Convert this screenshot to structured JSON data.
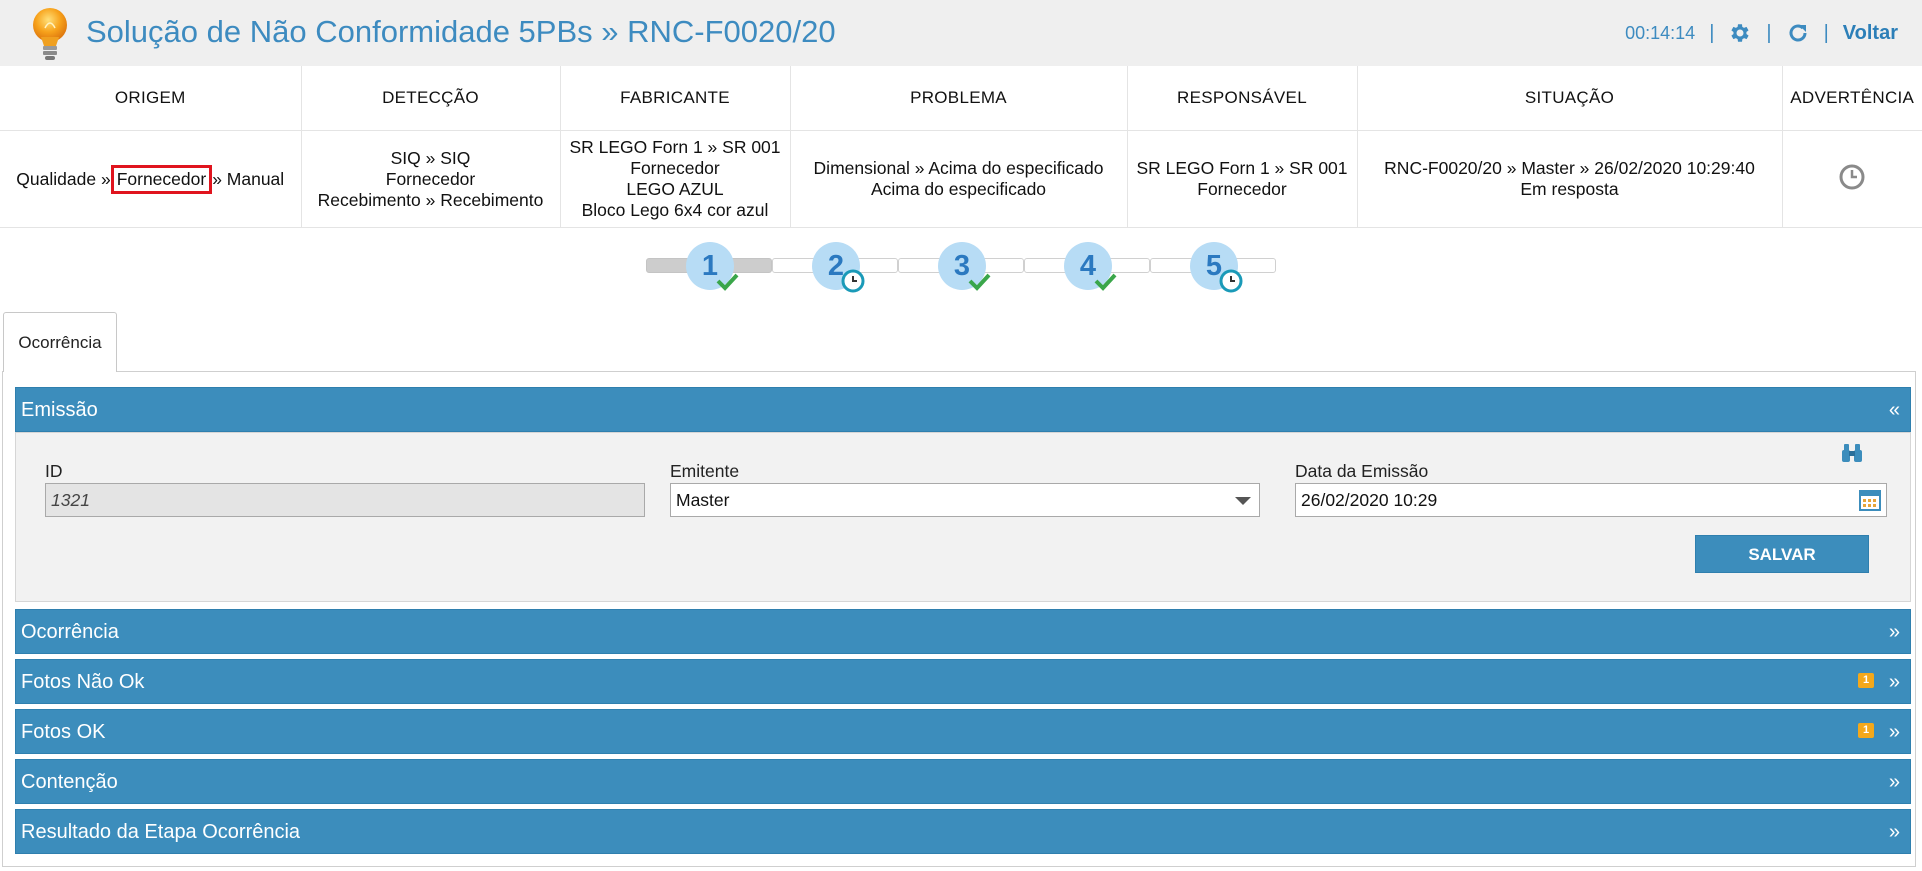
{
  "header": {
    "title": "Solução de Não Conformidade 5PBs » RNC-F0020/20",
    "timer": "00:14:14",
    "back_label": "Voltar",
    "icons": [
      "lightbulb-icon",
      "gear-icon",
      "refresh-icon"
    ]
  },
  "summary": {
    "columns": [
      "ORIGEM",
      "DETECÇÃO",
      "FABRICANTE",
      "PROBLEMA",
      "RESPONSÁVEL",
      "SITUAÇÃO",
      "ADVERTÊNCIA"
    ],
    "origem": {
      "part1": "Qualidade »",
      "highlight": "Fornecedor",
      "part3": "» Manual"
    },
    "deteccao": [
      "SIQ » SIQ",
      "Fornecedor",
      "Recebimento » Recebimento"
    ],
    "fabricante": [
      "SR LEGO Forn 1 » SR 001",
      "Fornecedor",
      "LEGO AZUL",
      "Bloco Lego 6x4 cor azul"
    ],
    "problema": [
      "Dimensional » Acima do especificado",
      "Acima do especificado"
    ],
    "responsavel": [
      "SR LEGO Forn 1 » SR 001",
      "Fornecedor"
    ],
    "situacao": [
      "RNC-F0020/20 » Master » 26/02/2020 10:29:40",
      "Em resposta"
    ],
    "advertencia_icon": "clock-icon"
  },
  "steps": [
    {
      "number": "1",
      "status": "check"
    },
    {
      "number": "2",
      "status": "clock"
    },
    {
      "number": "3",
      "status": "check"
    },
    {
      "number": "4",
      "status": "check"
    },
    {
      "number": "5",
      "status": "clock"
    }
  ],
  "tabs": [
    {
      "label": "Ocorrência",
      "active": true
    }
  ],
  "emissao": {
    "title": "Emissão",
    "collapse_icon": "«",
    "fields": {
      "id_label": "ID",
      "id_value": "1321",
      "emitente_label": "Emitente",
      "emitente_value": "Master",
      "data_label": "Data da Emissão",
      "data_value": "26/02/2020 10:29"
    },
    "save_label": "SALVAR"
  },
  "panels": [
    {
      "title": "Ocorrência",
      "count": "",
      "chevron": "»"
    },
    {
      "title": "Fotos Não Ok",
      "count": "1",
      "chevron": "»"
    },
    {
      "title": "Fotos OK",
      "count": "1",
      "chevron": "»"
    },
    {
      "title": "Contenção",
      "count": "",
      "chevron": "»"
    },
    {
      "title": "Resultado da Etapa Ocorrência",
      "count": "",
      "chevron": "»"
    }
  ],
  "colors": {
    "accent": "#3c8dbc",
    "title": "#3d8bc0",
    "highlight_border": "#e0141e",
    "step_bg": "#b7dcf5",
    "check": "#3aa64a",
    "badge": "#f4a81a"
  }
}
